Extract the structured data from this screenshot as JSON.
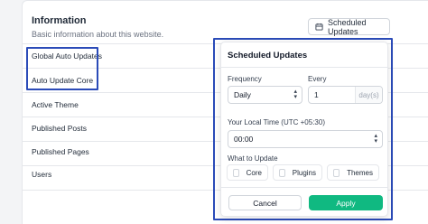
{
  "section": {
    "title": "Information",
    "subtitle": "Basic information about this website.",
    "scheduled_updates_label": "Scheduled Updates"
  },
  "rows": [
    {
      "label": "Global Auto Updates"
    },
    {
      "label": "Auto Update Core"
    },
    {
      "label": "Active Theme"
    },
    {
      "label": "Published Posts"
    },
    {
      "label": "Published Pages"
    },
    {
      "label": "Users"
    }
  ],
  "popover": {
    "title": "Scheduled Updates",
    "frequency_label": "Frequency",
    "frequency_value": "Daily",
    "every_label": "Every",
    "every_value": "1",
    "every_unit": "day(s)",
    "time_label": "Your Local Time (UTC +05:30)",
    "time_value": "00:00",
    "what_label": "What to Update",
    "options": [
      "Core",
      "Plugins",
      "Themes"
    ],
    "cancel_label": "Cancel",
    "apply_label": "Apply"
  },
  "colors": {
    "highlight": "#2b4bb8",
    "apply": "#10b981"
  },
  "icons": {
    "scheduled_button": "calendar-icon",
    "select": "chevron-updown-icon"
  }
}
